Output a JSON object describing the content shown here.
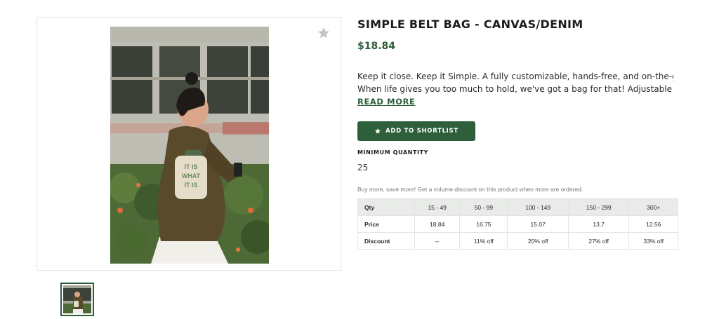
{
  "product": {
    "title": "SIMPLE BELT BAG - CANVAS/DENIM",
    "price": "$18.84",
    "description_lines": [
      "Keep it close. Keep it Simple. A fully customizable, hands-free, and on-the-go bag.",
      "When life gives you too much to hold, we've got a bag for that! Adjustable nylon..."
    ],
    "read_more": "READ MORE",
    "bag_print": [
      "IT IS",
      "WHAT",
      "IT IS"
    ]
  },
  "actions": {
    "add_to_shortlist": "ADD TO SHORTLIST"
  },
  "quantity": {
    "label": "MINIMUM QUANTITY",
    "value": "25"
  },
  "pricing": {
    "note": "Buy more, save more! Get a volume discount on this product when more are ordered.",
    "headers": [
      "Qty",
      "15 - 49",
      "50 - 99",
      "100 - 149",
      "150 - 299",
      "300+"
    ],
    "rows": [
      [
        "Price",
        "18.84",
        "16.75",
        "15.07",
        "13.7",
        "12.56"
      ],
      [
        "Discount",
        "--",
        "11% off",
        "20% off",
        "27% off",
        "33% off"
      ]
    ]
  },
  "colors": {
    "brand": "#2e5e3a",
    "table_header": "#e8ebe8",
    "favorite_star": "#c4c4c4"
  },
  "icons": {
    "favorite": "star-icon",
    "shortlist": "star-icon"
  }
}
